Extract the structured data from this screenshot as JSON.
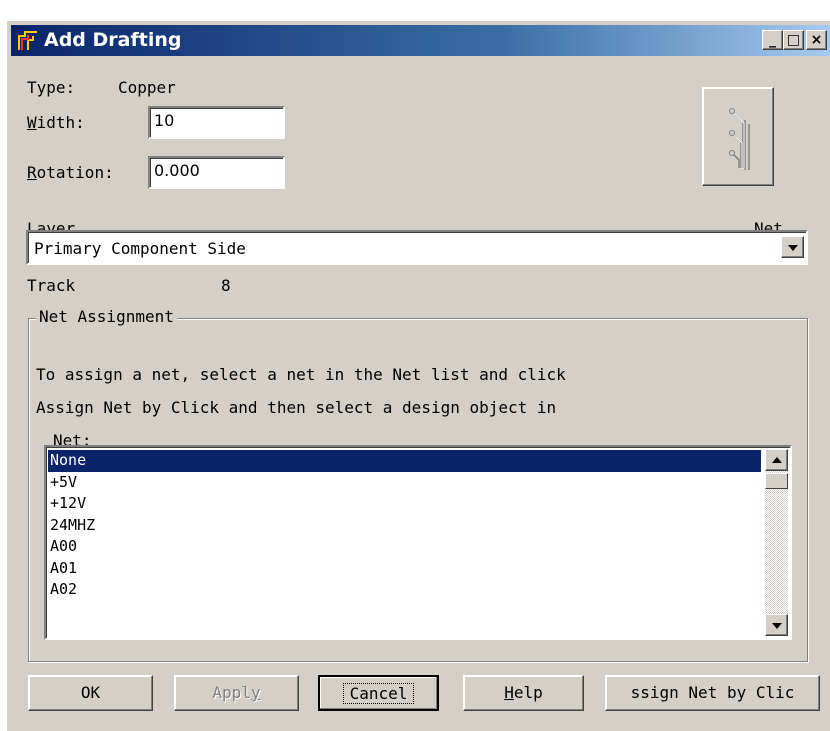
{
  "window": {
    "title": "Add Drafting",
    "controls": [
      "_",
      "□",
      "×"
    ]
  },
  "type": {
    "label": "Type:",
    "value": "Copper"
  },
  "width": {
    "label_first": "W",
    "label_rest": "idth:",
    "value": "10"
  },
  "rotation": {
    "label_first": "R",
    "label_rest": "otation:",
    "value": "0.000"
  },
  "net_button": {
    "label": "Net",
    "icon": "net-trace-icon"
  },
  "layer": {
    "label_pre": "Lay",
    "label_u": "e",
    "label_post": "r",
    "selected": "Primary Component Side"
  },
  "track": {
    "label": "Track",
    "value": "8"
  },
  "net_assignment": {
    "title": "Net Assignment",
    "instruction_line1": "To assign a net, select a net in the Net list and click",
    "instruction_line2": "Assign Net by Click and then select a design object in",
    "net_label_first": "N",
    "net_label_rest": "et:",
    "items": [
      "None",
      "+5V",
      "+12V",
      "24MHZ",
      "A00",
      "A01",
      "A02"
    ],
    "selected_index": 0
  },
  "buttons": {
    "ok": "OK",
    "apply_pre": "Appl",
    "apply_u": "y",
    "cancel": "Cancel",
    "help_u": "H",
    "help_rest": "elp",
    "assign": "ssign Net by Clic"
  }
}
